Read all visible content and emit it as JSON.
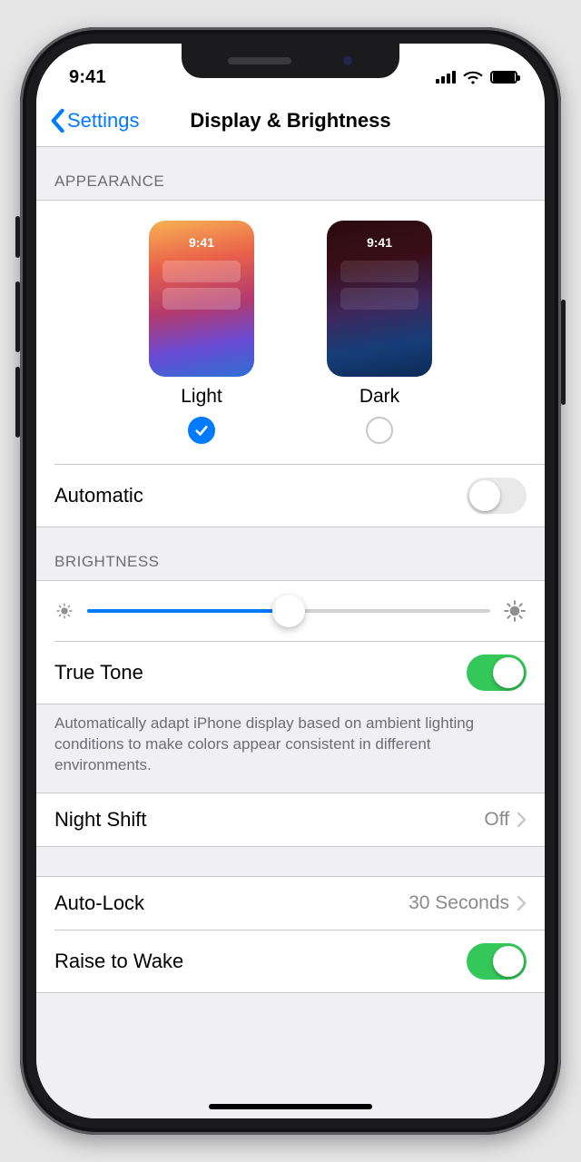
{
  "status": {
    "time": "9:41"
  },
  "nav": {
    "back_label": "Settings",
    "title": "Display & Brightness"
  },
  "appearance": {
    "header": "APPEARANCE",
    "options": [
      {
        "label": "Light",
        "preview_time": "9:41",
        "selected": true
      },
      {
        "label": "Dark",
        "preview_time": "9:41",
        "selected": false
      }
    ],
    "automatic": {
      "label": "Automatic",
      "on": false
    }
  },
  "brightness": {
    "header": "BRIGHTNESS",
    "value_percent": 50,
    "true_tone": {
      "label": "True Tone",
      "on": true
    },
    "footer": "Automatically adapt iPhone display based on ambient lighting conditions to make colors appear consistent in different environments."
  },
  "night_shift": {
    "label": "Night Shift",
    "value": "Off"
  },
  "auto_lock": {
    "label": "Auto-Lock",
    "value": "30 Seconds"
  },
  "raise_to_wake": {
    "label": "Raise to Wake",
    "on": true
  }
}
